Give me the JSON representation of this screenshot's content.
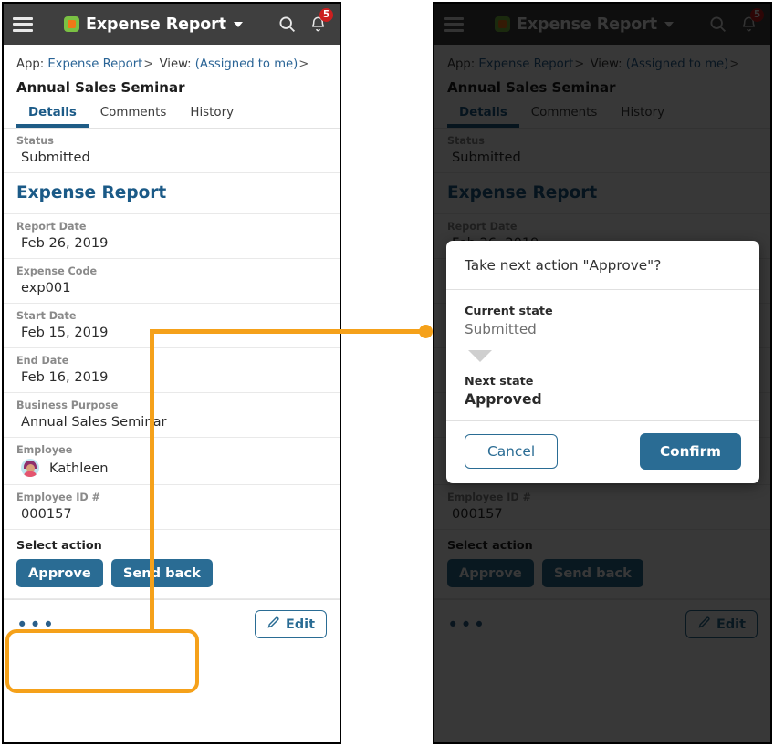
{
  "appbar": {
    "menu_icon": "hamburger-menu-icon",
    "logo_icon": "expense-report-app-logo",
    "title": "Expense Report",
    "dropdown_icon": "chevron-down-icon",
    "search_icon": "search-icon",
    "notifications_icon": "bell-icon",
    "notification_count": "5"
  },
  "breadcrumb": {
    "app_label": "App:",
    "app_value": "Expense Report",
    "sep1": ">",
    "view_label": "View:",
    "view_value": "(Assigned to me)",
    "sep2": ">"
  },
  "record": {
    "title": "Annual Sales Seminar"
  },
  "tabs": [
    {
      "label": "Details",
      "active": true
    },
    {
      "label": "Comments",
      "active": false
    },
    {
      "label": "History",
      "active": false
    }
  ],
  "status_field": {
    "label": "Status",
    "value": "Submitted"
  },
  "section": {
    "heading": "Expense Report"
  },
  "fields": [
    {
      "label": "Report Date",
      "value": "Feb 26, 2019"
    },
    {
      "label": "Expense Code",
      "value": "exp001"
    },
    {
      "label": "Start Date",
      "value": "Feb 15, 2019"
    },
    {
      "label": "End Date",
      "value": "Feb 16, 2019"
    },
    {
      "label": "Business Purpose",
      "value": "Annual Sales Seminar"
    }
  ],
  "employee_field": {
    "label": "Employee",
    "value": "Kathleen",
    "avatar_icon": "user-avatar"
  },
  "employee_id_field": {
    "label": "Employee ID #",
    "value": "000157"
  },
  "action_block": {
    "label": "Select action",
    "approve_label": "Approve",
    "send_back_label": "Send back"
  },
  "bottombar": {
    "more_icon": "ellipsis-icon",
    "more_label": "•••",
    "edit_icon": "pencil-icon",
    "edit_label": "Edit"
  },
  "modal": {
    "title": "Take next action \"Approve\"?",
    "current_state_label": "Current state",
    "current_state_value": "Submitted",
    "arrow_icon": "arrow-down-icon",
    "next_state_label": "Next state",
    "next_state_value": "Approved",
    "cancel_label": "Cancel",
    "confirm_label": "Confirm"
  },
  "annotation": {
    "callout_color": "#f5a11a",
    "target": "Select action"
  },
  "colors": {
    "appbar_bg": "#3f3f3f",
    "accent_blue": "#2a6c94",
    "link_blue": "#2a6496",
    "badge_red": "#cc1f1f",
    "callout_orange": "#f5a11a",
    "logo_green": "#7ac143",
    "logo_orange": "#f07818"
  }
}
